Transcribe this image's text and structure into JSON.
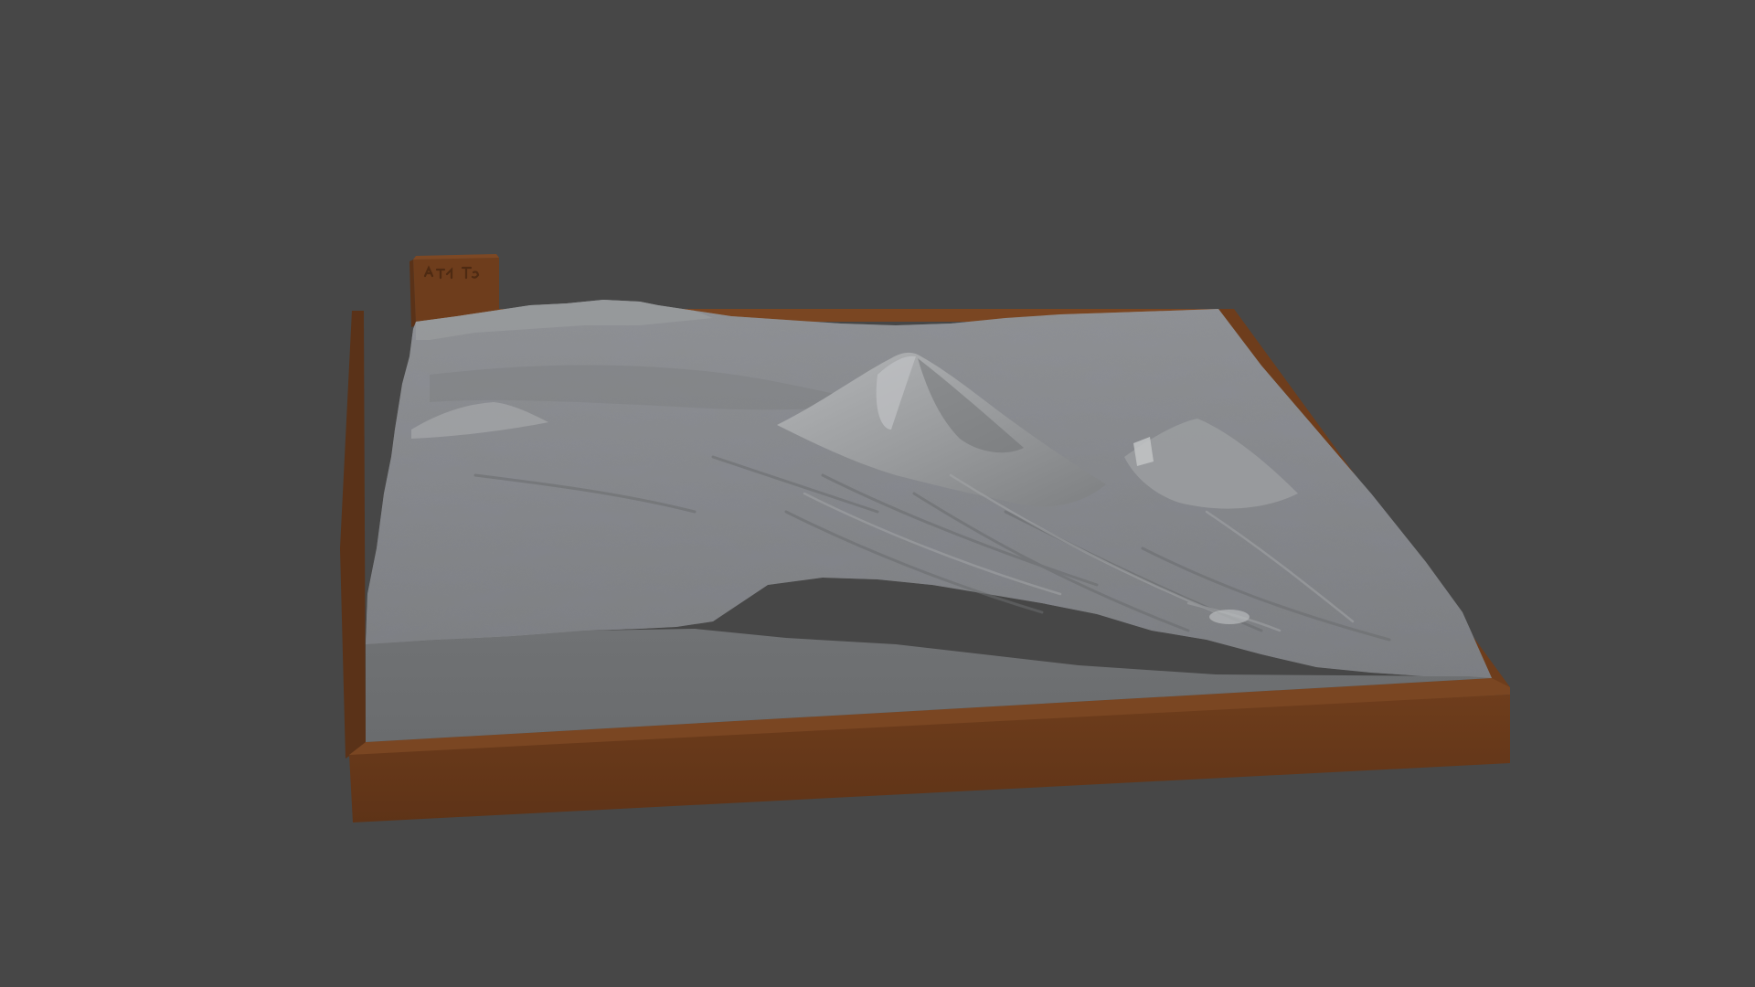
{
  "viewport": {
    "background_color": "#474747"
  },
  "model": {
    "base_color": "#6b3c1e",
    "base_side_color": "#5a3218",
    "base_top_color": "#7a4622",
    "terrain_color": "#8a8c8e",
    "terrain_flat_color": "#6e7072",
    "terrain_highlight_color": "#a4a6a8",
    "terrain_shadow_color": "#5c5e60",
    "badge_marks": [
      "A",
      "T",
      "Ta"
    ]
  }
}
